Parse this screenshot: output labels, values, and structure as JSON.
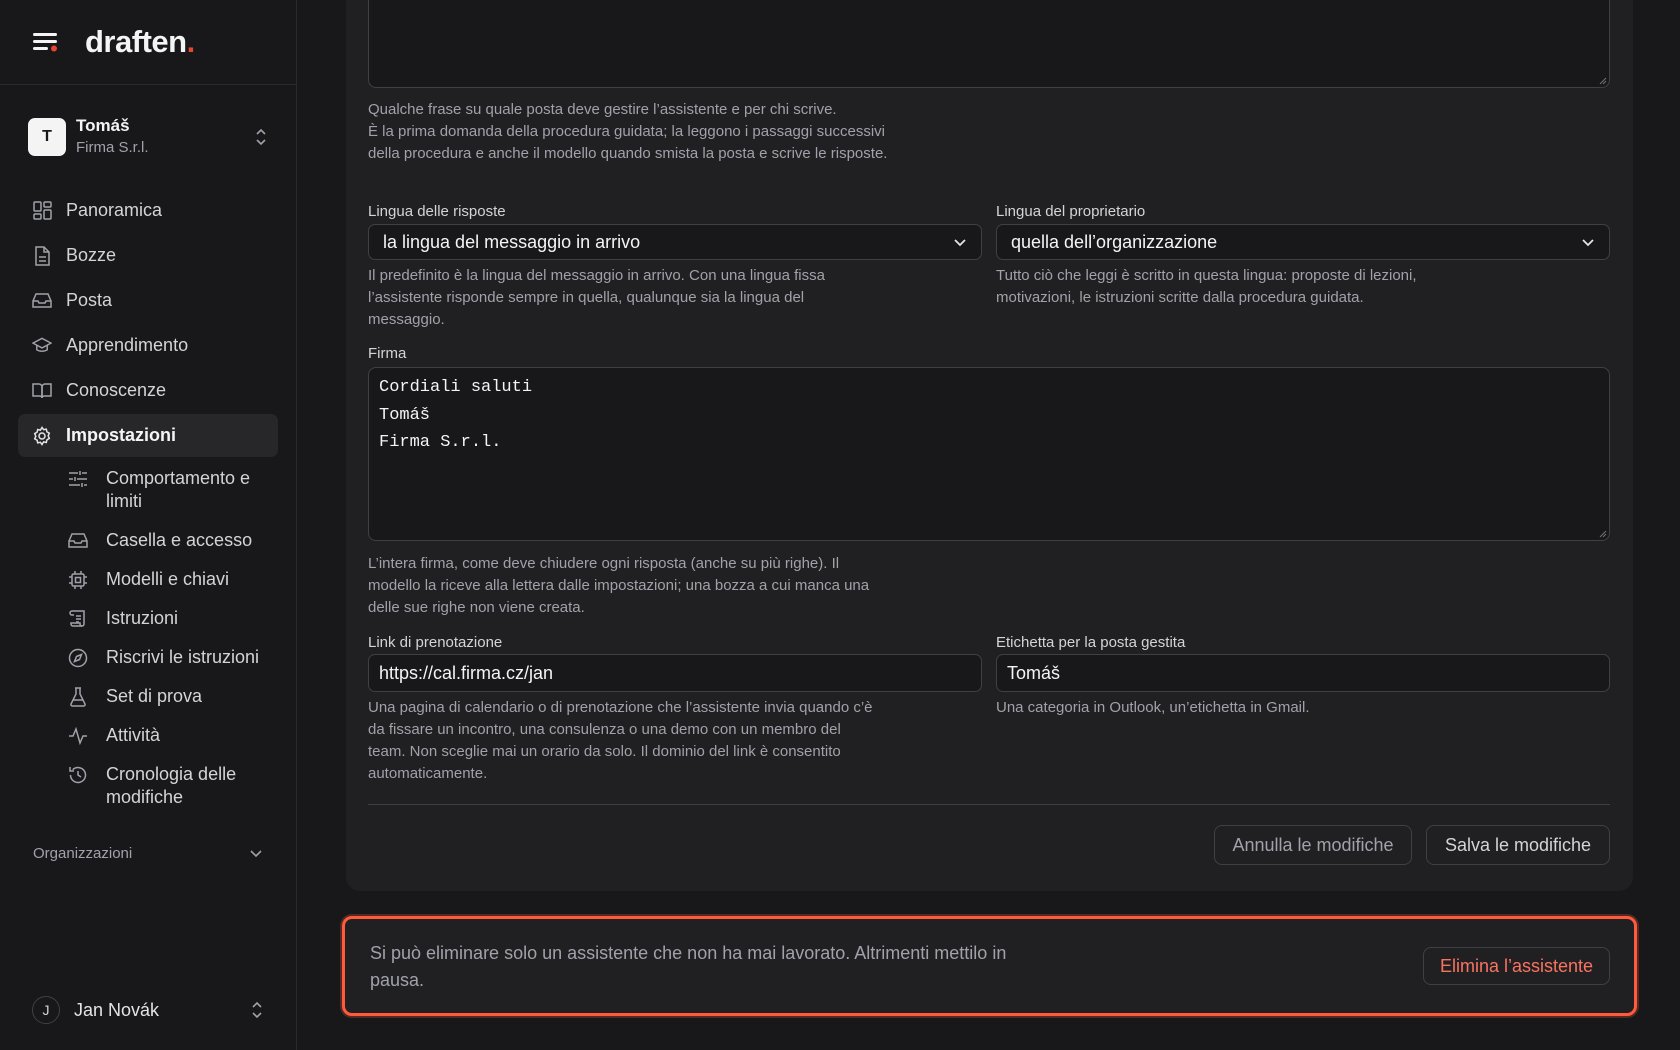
{
  "brand": {
    "name": "draften",
    "dot": "."
  },
  "account": {
    "initial": "T",
    "name": "Tomáš",
    "org": "Firma S.r.l."
  },
  "nav": {
    "items": [
      {
        "label": "Panoramica",
        "icon": "dashboard-icon"
      },
      {
        "label": "Bozze",
        "icon": "document-icon"
      },
      {
        "label": "Posta",
        "icon": "inbox-icon"
      },
      {
        "label": "Apprendimento",
        "icon": "graduation-cap-icon"
      },
      {
        "label": "Conoscenze",
        "icon": "book-icon"
      },
      {
        "label": "Impostazioni",
        "icon": "gear-icon",
        "active": true
      }
    ],
    "sub_items": [
      {
        "label": "Comportamento e limiti",
        "icon": "sliders-icon"
      },
      {
        "label": "Casella e accesso",
        "icon": "inbox-icon"
      },
      {
        "label": "Modelli e chiavi",
        "icon": "chip-icon"
      },
      {
        "label": "Istruzioni",
        "icon": "scroll-icon"
      },
      {
        "label": "Riscrivi le istruzioni",
        "icon": "compass-icon"
      },
      {
        "label": "Set di prova",
        "icon": "flask-icon"
      },
      {
        "label": "Attività",
        "icon": "activity-icon"
      },
      {
        "label": "Cronologia delle modifiche",
        "icon": "history-icon"
      }
    ]
  },
  "organizations_label": "Organizzazioni",
  "user": {
    "initial": "J",
    "name": "Jan Novák"
  },
  "form": {
    "description_help_1": "Qualche frase su quale posta deve gestire l’assistente e per chi scrive.",
    "description_help_2": "È la prima domanda della procedura guidata; la leggono i passaggi successivi della procedura e anche il modello quando smista la posta e scrive le risposte.",
    "reply_language_label": "Lingua delle risposte",
    "reply_language_value": "la lingua del messaggio in arrivo",
    "reply_language_help": "Il predefinito è la lingua del messaggio in arrivo. Con una lingua fissa l’assistente risponde sempre in quella, qualunque sia la lingua del messaggio.",
    "owner_language_label": "Lingua del proprietario",
    "owner_language_value": "quella dell’organizzazione",
    "owner_language_help": "Tutto ciò che leggi è scritto in questa lingua: proposte di lezioni, motivazioni, le istruzioni scritte dalla procedura guidata.",
    "signature_label": "Firma",
    "signature_lines": [
      "Cordiali saluti",
      "Tomáš",
      "Firma S.r.l."
    ],
    "signature_help": "L’intera firma, come deve chiudere ogni risposta (anche su più righe). Il modello la riceve alla lettera dalle impostazioni; una bozza a cui manca una delle sue righe non viene creata.",
    "booking_label": "Link di prenotazione",
    "booking_value": "https://cal.firma.cz/jan",
    "booking_help": "Una pagina di calendario o di prenotazione che l’assistente invia quando c’è da fissare un incontro, una consulenza o una demo con un membro del team. Non sceglie mai un orario da solo. Il dominio del link è consentito automaticamente.",
    "tag_label": "Etichetta per la posta gestita",
    "tag_value": "Tomáš",
    "tag_help": "Una categoria in Outlook, un’etichetta in Gmail.",
    "cancel_label": "Annulla le modifiche",
    "save_label": "Salva le modifiche"
  },
  "danger": {
    "text": "Si può eliminare solo un assistente che non ha mai lavorato. Altrimenti mettilo in pausa.",
    "button": "Elimina l’assistente"
  },
  "colors": {
    "accent": "#e8452f",
    "danger_border": "#ff5a3c",
    "danger_text": "#f97360",
    "background": "#18181b"
  }
}
